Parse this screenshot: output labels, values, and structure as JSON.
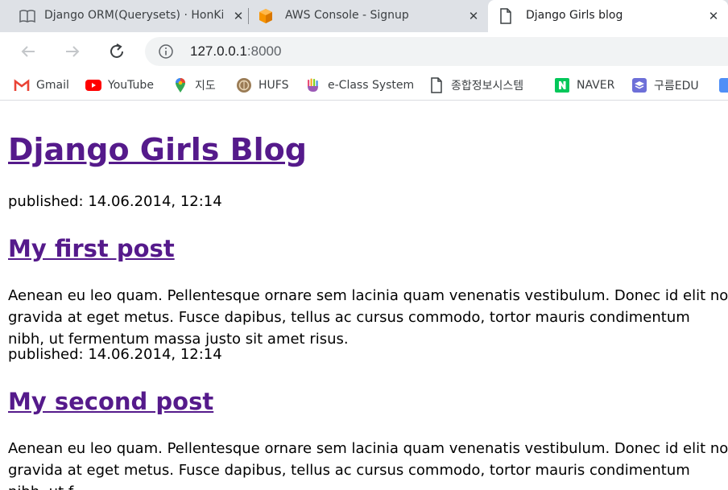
{
  "browser": {
    "tabs": [
      {
        "title": "Django ORM(Querysets) · HonKit",
        "icon": "book-icon"
      },
      {
        "title": "AWS Console - Signup",
        "icon": "aws-cube-icon"
      },
      {
        "title": "Django Girls blog",
        "icon": "page-icon",
        "active": true
      }
    ],
    "close_glyph": "✕",
    "address": {
      "host": "127.0.0.1",
      "port": ":8000"
    },
    "bookmarks": [
      {
        "label": "Gmail",
        "icon": "gmail-icon"
      },
      {
        "label": "YouTube",
        "icon": "youtube-icon"
      },
      {
        "label": "지도",
        "icon": "maps-pin-icon"
      },
      {
        "label": "HUFS",
        "icon": "hufs-emblem-icon"
      },
      {
        "label": "e-Class System",
        "icon": "eclass-hand-icon"
      },
      {
        "label": "종합정보시스템",
        "icon": "page-icon"
      },
      {
        "label": "NAVER",
        "icon": "naver-icon"
      },
      {
        "label": "구름EDU",
        "icon": "goorm-icon"
      }
    ]
  },
  "page": {
    "blog_title": "Django Girls Blog",
    "posts": [
      {
        "published": "published: 14.06.2014, 12:14",
        "title": "My first post",
        "text": "Aenean eu leo quam. Pellentesque ornare sem lacinia quam venenatis vestibulum. Donec id elit non mi porta gravida at eget metus. Fusce dapibus, tellus ac cursus commodo, tortor mauris condimentum\nnibh, ut fermentum massa justo sit amet risus."
      },
      {
        "published": "published: 14.06.2014, 12:14",
        "title": "My second post",
        "text": "Aenean eu leo quam. Pellentesque ornare sem lacinia quam venenatis vestibulum. Donec id elit non mi porta gravida at eget metus. Fusce dapibus, tellus ac cursus commodo, tortor mauris condimentum\nnibh, ut f."
      }
    ]
  }
}
